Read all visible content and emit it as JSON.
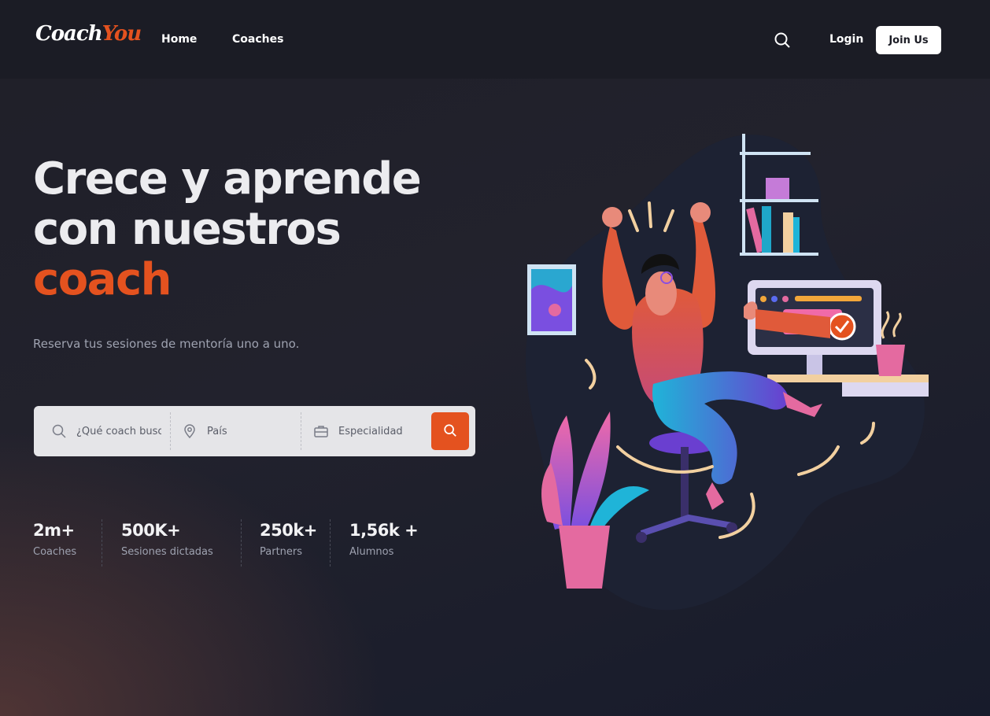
{
  "brand": {
    "part1": "Coach",
    "part2": "You"
  },
  "nav": {
    "links": [
      {
        "label": "Home"
      },
      {
        "label": "Coaches"
      }
    ],
    "search_icon": "search-icon",
    "login_label": "Login",
    "join_label": "Join Us"
  },
  "hero": {
    "title_line1": "Crece y aprende",
    "title_line2": "con nuestros",
    "title_accent": "coach",
    "subtitle": "Reserva tus sesiones de mentoría uno a uno."
  },
  "search": {
    "coach_placeholder": "¿Qué coach buscas?",
    "country_placeholder": "País",
    "specialty_placeholder": "Especialidad",
    "icons": [
      "search-icon",
      "location-pin-icon",
      "briefcase-icon",
      "search-icon"
    ]
  },
  "stats": [
    {
      "value": "2m+",
      "label": "Coaches"
    },
    {
      "value": "500K+",
      "label": "Sesiones dictadas"
    },
    {
      "value": "250k+",
      "label": "Partners"
    },
    {
      "value": "1,56k +",
      "label": "Alumnos"
    }
  ],
  "colors": {
    "accent": "#e4521f",
    "background": "#1f1f28",
    "nav": "#1b1c25",
    "search_bar": "#e5e5e8"
  }
}
